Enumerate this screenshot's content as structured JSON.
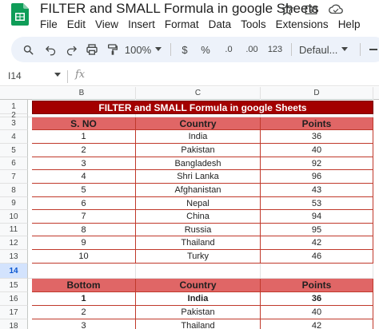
{
  "app": {
    "doc_title": "FILTER and SMALL Formula in google Sheets",
    "menu": [
      "File",
      "Edit",
      "View",
      "Insert",
      "Format",
      "Data",
      "Tools",
      "Extensions",
      "Help"
    ]
  },
  "toolbar": {
    "zoom": "100%",
    "currency": "$",
    "percent": "%",
    "decrease_decimal": ".0",
    "increase_decimal": ".00",
    "number_format": "123",
    "font": "Defaul..."
  },
  "formula_bar": {
    "name_box": "I14",
    "fx": "fx",
    "formula": ""
  },
  "columns": [
    "B",
    "C",
    "D"
  ],
  "rows": [
    "1",
    "2",
    "3",
    "4",
    "5",
    "6",
    "7",
    "8",
    "9",
    "10",
    "11",
    "12",
    "13",
    "14",
    "15",
    "16",
    "17",
    "18"
  ],
  "selected_row": "14",
  "sheet": {
    "title": "FILTER and SMALL Formula in google Sheets",
    "table1": {
      "headers": [
        "S. NO",
        "Country",
        "Points"
      ],
      "rows": [
        [
          "1",
          "India",
          "36"
        ],
        [
          "2",
          "Pakistan",
          "40"
        ],
        [
          "3",
          "Bangladesh",
          "92"
        ],
        [
          "4",
          "Shri Lanka",
          "96"
        ],
        [
          "5",
          "Afghanistan",
          "43"
        ],
        [
          "6",
          "Nepal",
          "53"
        ],
        [
          "7",
          "China",
          "94"
        ],
        [
          "8",
          "Russia",
          "95"
        ],
        [
          "9",
          "Thailand",
          "42"
        ],
        [
          "10",
          "Turky",
          "46"
        ]
      ]
    },
    "table2": {
      "headers": [
        "Bottom",
        "Country",
        "Points"
      ],
      "rows": [
        [
          "1",
          "India",
          "36"
        ],
        [
          "2",
          "Pakistan",
          "40"
        ],
        [
          "3",
          "Thailand",
          "42"
        ]
      ]
    }
  }
}
